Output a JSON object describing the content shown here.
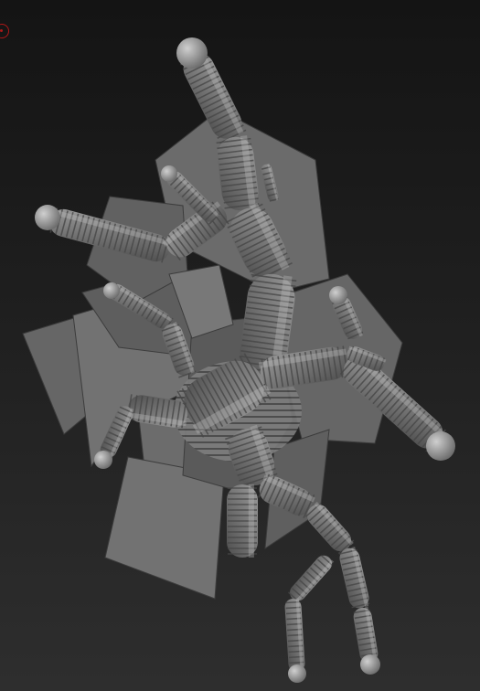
{
  "scene": {
    "background_top": "#141414",
    "background_bottom": "#2e2e2e",
    "plane_color": "#6b6b6b",
    "tube_color": "#7a7a7a",
    "ring_color": "#4a4a4a",
    "cursor_color": "#b01818"
  },
  "icons": {
    "cursor": "brush-cursor-circle-icon"
  }
}
